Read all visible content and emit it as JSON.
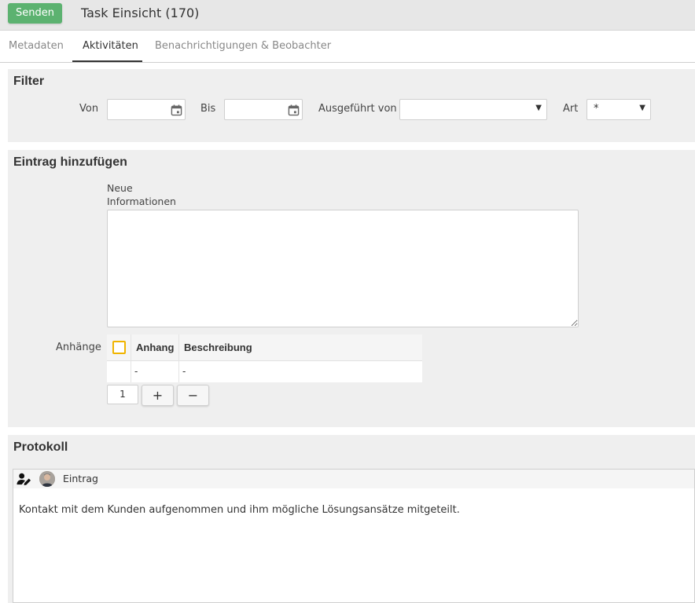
{
  "header": {
    "send_label": "Senden",
    "title": "Task Einsicht (170)"
  },
  "tabs": [
    {
      "label": "Metadaten",
      "active": false
    },
    {
      "label": "Aktivitäten",
      "active": true
    },
    {
      "label": "Benachrichtigungen & Beobachter",
      "active": false
    }
  ],
  "filter": {
    "title": "Filter",
    "von_label": "Von",
    "von_value": "",
    "bis_label": "Bis",
    "bis_value": "",
    "executed_by_label": "Ausgeführt von",
    "executed_by_value": "",
    "art_label": "Art",
    "art_value": "*"
  },
  "add_entry": {
    "title": "Eintrag hinzufügen",
    "new_info_label_line1": "Neue",
    "new_info_label_line2": "Informationen",
    "new_info_value": "",
    "attachments_label": "Anhänge",
    "attachments_columns": [
      "Anhang",
      "Beschreibung"
    ],
    "attachments_rows": [
      {
        "anhang": "-",
        "beschreibung": "-"
      }
    ],
    "row_count": "1",
    "add_symbol": "+",
    "remove_symbol": "−"
  },
  "protocol": {
    "title": "Protokoll",
    "entry_label": "Eintrag",
    "entry_text": "Kontakt mit dem Kunden aufgenommen und ihm mögliche Lösungsansätze mitgeteilt."
  },
  "colors": {
    "send_button": "#5cb270",
    "checkbox_border": "#f0b400",
    "panel_background": "#efefef"
  }
}
